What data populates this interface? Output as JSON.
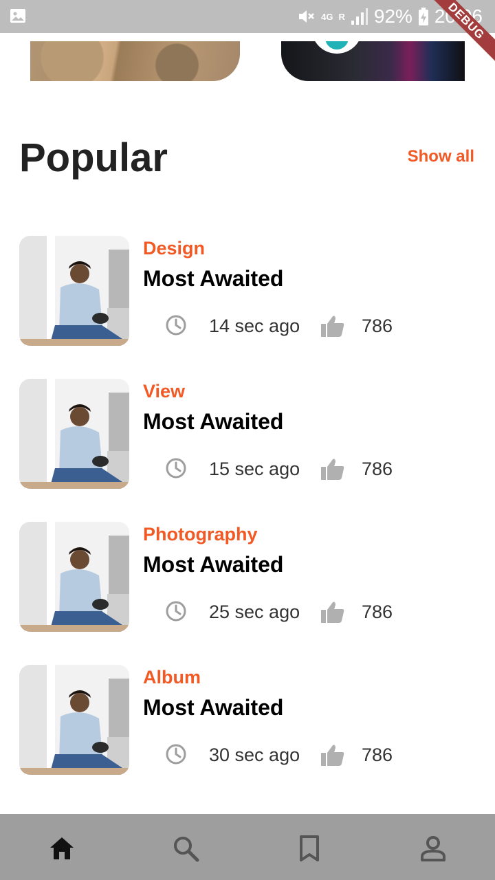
{
  "status_bar": {
    "icons": [
      "image-notification-icon",
      "mute-icon",
      "network-4g-icon",
      "signal-icon",
      "battery-charging-icon"
    ],
    "network": "4G",
    "roaming": "R",
    "battery": "92%",
    "time": "20:06",
    "debug_badge": "DEBUG"
  },
  "featured": {
    "cards": [
      {
        "name": "featured-card-1"
      },
      {
        "name": "featured-card-2"
      }
    ]
  },
  "popular": {
    "title": "Popular",
    "show_all_label": "Show all",
    "accent_color": "#f15a24",
    "items": [
      {
        "category": "Design",
        "title": "Most Awaited",
        "time": "14 sec ago",
        "likes": "786"
      },
      {
        "category": "View",
        "title": "Most Awaited",
        "time": "15 sec ago",
        "likes": "786"
      },
      {
        "category": "Photography",
        "title": "Most Awaited",
        "time": "25 sec ago",
        "likes": "786"
      },
      {
        "category": "Album",
        "title": "Most Awaited",
        "time": "30 sec ago",
        "likes": "786"
      }
    ]
  },
  "bottom_nav": {
    "background": "#9e9e9e",
    "items": [
      {
        "icon": "home-icon",
        "active": true
      },
      {
        "icon": "search-icon",
        "active": false
      },
      {
        "icon": "bookmark-icon",
        "active": false
      },
      {
        "icon": "profile-icon",
        "active": false
      }
    ]
  }
}
